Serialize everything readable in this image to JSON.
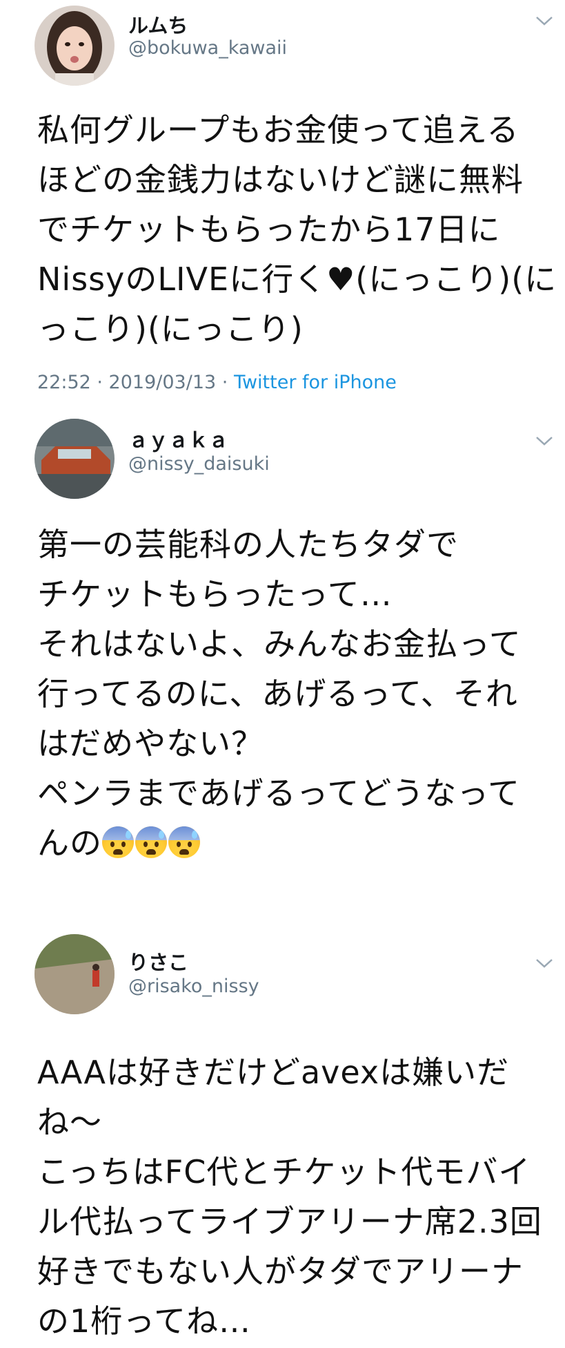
{
  "tweets": [
    {
      "name": "ルムち",
      "handle": "@bokuwa_kawaii",
      "avatar_icon": "avatar-photo-girl",
      "lines": [
        "私何グループもお金使って追える",
        "ほどの金銭力はないけど謎に無料",
        "でチケットもらったから17日に",
        "NissyのLIVEに行く♥(にっこり)(に",
        "っこり)(にっこり)"
      ],
      "time": "22:52 · 2019/03/13 · ",
      "source": "Twitter for iPhone"
    },
    {
      "name": "ａｙａｋａ",
      "handle": "@nissy_daisuki",
      "avatar_icon": "avatar-photo-car",
      "lines": [
        "第一の芸能科の人たちタダで",
        "チケットもらったって…",
        "それはないよ、みんなお金払って",
        "行ってるのに、あげるって、それ",
        "はだめやない？",
        "ペンラまであげるってどうなって",
        "んの"
      ],
      "emoji": [
        "anxious-sweat-face",
        "anxious-sweat-face",
        "anxious-sweat-face"
      ]
    },
    {
      "name": "りさこ",
      "handle": "@risako_nissy",
      "avatar_icon": "avatar-photo-park",
      "lines": [
        "AAAは好きだけどavexは嫌いだ",
        "ね〜",
        "こっちはFC代とチケット代モバイ",
        "ル代払ってライブアリーナ席2.3回",
        "好きでもない人がタダでアリーナ",
        "の1桁ってね…"
      ]
    }
  ],
  "colors": {
    "handle": "#657786",
    "link": "#1b95e0",
    "text": "#14171a"
  }
}
